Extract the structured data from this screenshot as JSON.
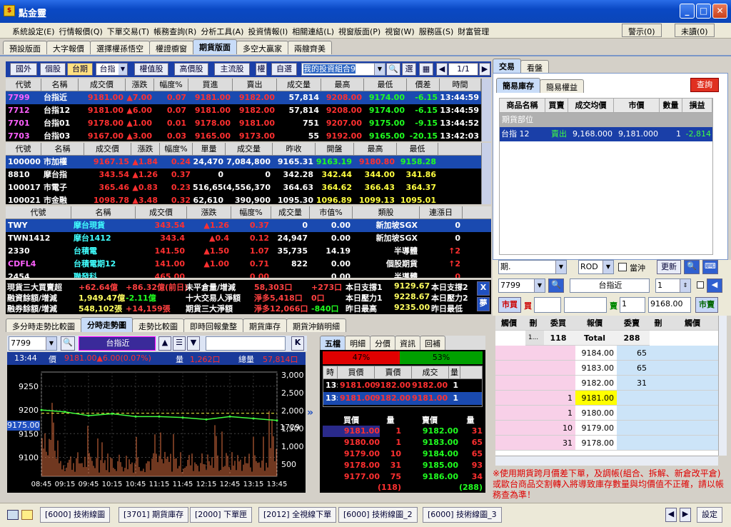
{
  "app": {
    "title": "點金靈",
    "icon": "gold-coin-icon"
  },
  "menu": [
    "系統設定(E)",
    "行情報價(Q)",
    "下單交易(T)",
    "帳務查詢(R)",
    "分析工具(A)",
    "投資情報(I)",
    "相關連結(L)",
    "視窗版面(P)",
    "視窗(W)",
    "服務區(S)",
    "財富管理"
  ],
  "menu_right": {
    "warn": "警示(0)",
    "unconfirmed": "未讀(0)"
  },
  "layout_tabs": [
    "預設版面",
    "大字報價",
    "選擇權孫悟空",
    "權證櫥窗",
    "期貨版面",
    "多空大贏家",
    "兩艘齊美"
  ],
  "toolbar": {
    "buttons": [
      "國外",
      "個股",
      "台期",
      "權值股",
      "高價股",
      "主流股",
      "權",
      "自選"
    ],
    "market_sel": "台指",
    "portfolio": "我的投資組合9",
    "pick": "選",
    "page": "1/1"
  },
  "fut_table": {
    "headers": [
      "代號",
      "名稱",
      "成交價",
      "漲跌",
      "幅度%",
      "買進",
      "賣出",
      "成交量",
      "最高",
      "最低",
      "價差",
      "時間"
    ],
    "rows": [
      [
        "7799",
        "台指近",
        "9181.00",
        "▲7.00",
        "0.07",
        "9181.00",
        "9182.00",
        "57,814",
        "9208.00",
        "9174.00",
        "-6.15",
        "13:44:59"
      ],
      [
        "7712",
        "台指12",
        "9181.00",
        "▲6.00",
        "0.07",
        "9181.00",
        "9182.00",
        "57,814",
        "9208.00",
        "9174.00",
        "-6.15",
        "13:44:59"
      ],
      [
        "7701",
        "台指01",
        "9178.00",
        "▲1.00",
        "0.01",
        "9178.00",
        "9181.00",
        "751",
        "9207.00",
        "9175.00",
        "-9.15",
        "13:44:52"
      ],
      [
        "7703",
        "台指03",
        "9167.00",
        "▲3.00",
        "0.03",
        "9165.00",
        "9173.00",
        "55",
        "9192.00",
        "9165.00",
        "-20.15",
        "13:42:03"
      ]
    ]
  },
  "idx_table": {
    "headers": [
      "代號",
      "名稱",
      "成交價",
      "漲跌",
      "幅度%",
      "單量",
      "成交量",
      "昨收",
      "開盤",
      "最高",
      "最低"
    ],
    "rows": [
      [
        "100000",
        "市加權",
        "9167.15",
        "▲1.84",
        "0.24",
        "24,470",
        "7,084,800",
        "9165.31",
        "9163.19",
        "9180.80",
        "9158.28"
      ],
      [
        "8810",
        "摩台指",
        "343.54",
        "▲1.26",
        "0.37",
        "0",
        "0",
        "342.28",
        "342.44",
        "344.00",
        "341.86"
      ],
      [
        "100017",
        "市電子",
        "365.46",
        "▲0.83",
        "0.23",
        "516,650",
        "4,556,370",
        "364.63",
        "364.62",
        "366.43",
        "364.37"
      ],
      [
        "100021",
        "市金融",
        "1098.78",
        "▲3.48",
        "0.32",
        "62,610",
        "390,900",
        "1095.30",
        "1096.89",
        "1099.13",
        "1095.01"
      ]
    ]
  },
  "stk_table": {
    "headers": [
      "代號",
      "名稱",
      "成交價",
      "漲跌",
      "幅度%",
      "成交量",
      "市值%",
      "類股",
      "連漲日"
    ],
    "rows": [
      [
        "TWY",
        "摩台現貨",
        "343.54",
        "▲1.26",
        "0.37",
        "0",
        "0.00",
        "新加坡SGX",
        "0"
      ],
      [
        "TWN1412",
        "摩台1412",
        "343.4",
        "▲0.4",
        "0.12",
        "24,947",
        "0.00",
        "新加坡SGX",
        "0"
      ],
      [
        "2330",
        "台積電",
        "141.50",
        "▲1.50",
        "1.07",
        "35,735",
        "14.19",
        "半導體",
        "↑2"
      ],
      [
        "CDFL4",
        "台積電期12",
        "141.00",
        "▲1.00",
        "0.71",
        "822",
        "0.00",
        "個股期貨",
        "↑2"
      ],
      [
        "2454",
        "聯發科",
        "465.00",
        "",
        "0.00",
        "",
        "0.00",
        "半導體",
        "0"
      ]
    ]
  },
  "info": {
    "l1": [
      "現貨三大買賣超",
      "+62.64億",
      "+86.32億(前日)",
      "未平倉量/增減",
      "58,303口",
      "+273口",
      "本日支撐1",
      "9129.67",
      "本日支撐2"
    ],
    "l2": [
      "融資餘額/增減",
      "1,949.47億",
      "-2.11億",
      "十大交易人淨額",
      "淨多5,418口",
      "0口",
      "本日壓力1",
      "9228.67",
      "本日壓力2"
    ],
    "l3": [
      "融券餘額/增減",
      "548,102張",
      "+14,159張",
      "期貨三大淨額",
      "淨多12,066口",
      "-840口",
      "昨日最高",
      "9235.00",
      "昨日最低"
    ],
    "btn1": "X",
    "btn2": "夢"
  },
  "tabs_mid": [
    "多分時走勢比較圖",
    "分時走勢圖",
    "走勢比較圖",
    "即時回報彙整",
    "期貨庫存",
    "期貨沖銷明細"
  ],
  "chart_ui": {
    "code": "7799",
    "name": "台指近",
    "time": "13:44",
    "price_lbl": "價",
    "price": "9181.00▲6.00(0.07%)",
    "vol_lbl": "量",
    "vol": "1,262口",
    "tot_lbl": "總量",
    "tot": "57,814口",
    "k": "K",
    "cur": "9175.00",
    "vol_cur": "1729"
  },
  "chart_data": {
    "type": "line",
    "x": [
      "08:45",
      "09:15",
      "09:45",
      "10:15",
      "10:45",
      "11:15",
      "11:45",
      "12:15",
      "12:45",
      "13:15",
      "13:45"
    ],
    "price": [
      9200,
      9196,
      9188,
      9192,
      9186,
      9186,
      9184,
      9180,
      9186,
      9182,
      9178
    ],
    "ylim": [
      9060,
      9280
    ],
    "yticks": [
      9250,
      9200,
      9150,
      9100
    ],
    "vol_yticks": [
      "3,000",
      "2,500",
      "2,000",
      "1,500",
      "1,000",
      "500"
    ],
    "vol_max": 3200
  },
  "order_tabs": [
    "五檔",
    "明細",
    "分價",
    "資訊",
    "回補"
  ],
  "ratio": {
    "buy": "47%",
    "sell": "53%"
  },
  "detail": {
    "headers": [
      "時",
      "買價",
      "賣價",
      "成交",
      "量"
    ],
    "rows": [
      [
        "13:44",
        "9181.00",
        "9182.00",
        "9182.00",
        "1"
      ],
      [
        "13:44",
        "9181.00",
        "9182.00",
        "9181.00",
        "1"
      ]
    ]
  },
  "five": {
    "headers": [
      "買價",
      "量",
      "賣價",
      "量"
    ],
    "rows": [
      [
        "9181.00",
        "1",
        "9182.00",
        "31"
      ],
      [
        "9180.00",
        "1",
        "9183.00",
        "65"
      ],
      [
        "9179.00",
        "10",
        "9184.00",
        "65"
      ],
      [
        "9178.00",
        "31",
        "9185.00",
        "93"
      ],
      [
        "9177.00",
        "75",
        "9186.00",
        "34"
      ]
    ],
    "tot_buy": "(118)",
    "tot_sell": "(288)"
  },
  "right": {
    "tabs": [
      "交易",
      "看盤"
    ],
    "subtabs": [
      "簡易庫存",
      "簡易權益"
    ],
    "query": "查詢",
    "headers": [
      "商品名稱",
      "買賣",
      "成交均價",
      "市價",
      "數量",
      "損益"
    ],
    "group": "期貨部位",
    "row": [
      "台指 12",
      "賣出",
      "9,168.000",
      "9,181.000",
      "1",
      "-2,814"
    ]
  },
  "order": {
    "type": "期.",
    "rod": "ROD",
    "daytrade": "當沖",
    "update": "更新",
    "code": "7799",
    "name": "台指近",
    "qty": "1",
    "mkt": "市買",
    "buy": "買",
    "sell": "賣",
    "sell_qty": "1",
    "sell_px": "9168.00",
    "mkt2": "市賣"
  },
  "book": {
    "headers": [
      "觸價",
      "刪",
      "委買",
      "報價",
      "委賣",
      "刪",
      "觸價"
    ],
    "tot_buy": "118",
    "tot_lbl": "Total",
    "tot_sell": "288",
    "btn": "1...",
    "rows": [
      [
        "",
        "9184.00",
        "65"
      ],
      [
        "",
        "9183.00",
        "65"
      ],
      [
        "",
        "9182.00",
        "31"
      ],
      [
        "1",
        "9181.00",
        ""
      ],
      [
        "1",
        "9180.00",
        ""
      ],
      [
        "10",
        "9179.00",
        ""
      ],
      [
        "31",
        "9178.00",
        ""
      ]
    ]
  },
  "notice": "※使用期貨跨月價差下單，及調帳(組合、拆解、新倉改平倉)或歐台商品交割轉入將導致庫存數量與均價值不正確，請以帳務查為準！",
  "taskbar": [
    "[6000] 技術線圖",
    "[3701] 期貨庫存",
    "[2000] 下單匣",
    "[2012] 全視線下單",
    "[6000] 技術線圖_2",
    "[6000] 技術線圖_3"
  ],
  "setting": "設定"
}
